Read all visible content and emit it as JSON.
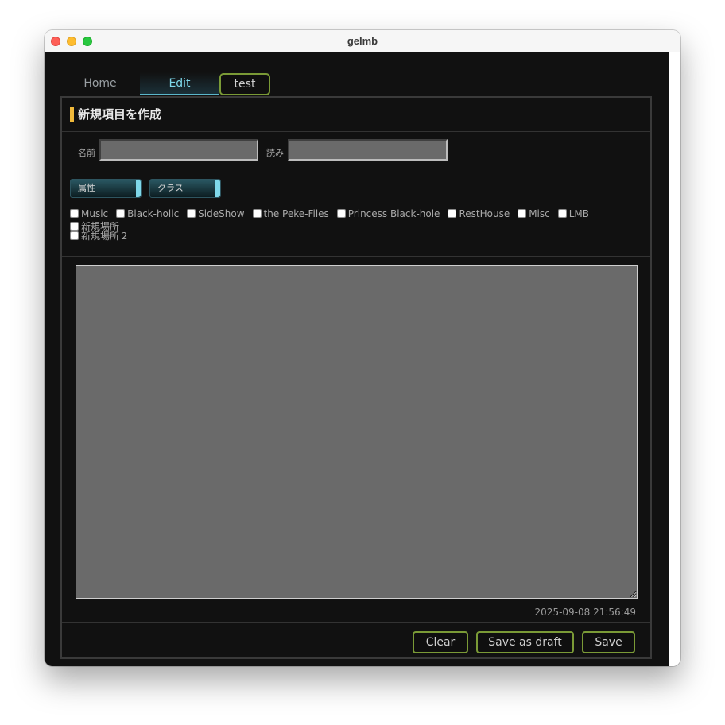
{
  "window": {
    "title": "gelmb"
  },
  "tabs": {
    "home": "Home",
    "edit": "Edit",
    "test": "test"
  },
  "form": {
    "heading": "新規項目を作成",
    "name_label": "名前",
    "name_value": "",
    "reading_label": "読み",
    "reading_value": "",
    "attribute_select": "属性",
    "class_select": "クラス",
    "categories": [
      "Music",
      "Black-holic",
      "SideShow",
      "the Peke-Files",
      "Princess Black-hole",
      "RestHouse",
      "Misc",
      "LMB",
      "新規場所",
      "新規場所２"
    ],
    "body_value": "",
    "timestamp": "2025-09-08 21:56:49"
  },
  "buttons": {
    "clear": "Clear",
    "save_draft": "Save as draft",
    "save": "Save"
  },
  "colors": {
    "accent_cyan": "#7fd8ea",
    "accent_green": "#7a9a36",
    "heading_marker": "#f0b93a",
    "background": "#111111"
  }
}
